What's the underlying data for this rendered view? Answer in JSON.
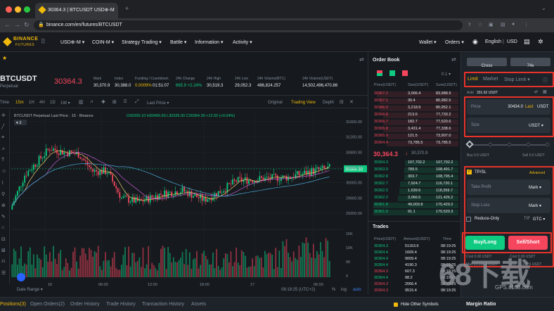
{
  "browser": {
    "tab_title": "30364.3 | BTCUSDT USD⊕-M",
    "url": "binance.com/en/futures/BTCUSDT",
    "new_tab_icon": "plus-icon"
  },
  "nav": {
    "logo_line1": "BINANCE",
    "logo_line2": "FUTURES",
    "items": [
      "USD⊕-M ▾",
      "COIN-M ▾",
      "Strategy Trading ▾",
      "Battle ▾",
      "Information ▾",
      "Activity ▾"
    ],
    "wallet": "Wallet ▾",
    "orders": "Orders ▾",
    "language": "English",
    "currency": "USD"
  },
  "ticker": {
    "symbol": "BTCUSDT",
    "type": "Perpetual",
    "last_price": "30364.3",
    "stats": [
      {
        "label": "Mark",
        "value": "30,370.9",
        "color": "w"
      },
      {
        "label": "Index",
        "value": "30,388.0",
        "color": "w"
      },
      {
        "label": "Funding / Countdown",
        "value": "0.0009%",
        "value2": "01:51:07",
        "color": "y"
      },
      {
        "label": "24h Change",
        "value": "665.9 +2.24%",
        "color": "g"
      },
      {
        "label": "24h High",
        "value": "30,519.3",
        "color": "w"
      },
      {
        "label": "24h Low",
        "value": "29,052.3",
        "color": "w"
      },
      {
        "label": "24h Volume(BTC)",
        "value": "486,824.257",
        "color": "w"
      },
      {
        "label": "24h Volume(USDT)",
        "value": "14,502,496,470.86",
        "color": "w"
      }
    ]
  },
  "chart_toolbar": {
    "intervals": [
      "Time",
      "15m",
      "1H",
      "4H",
      "1D",
      "1W ▾"
    ],
    "active_interval": "15m",
    "last_price_select": "Last Price ▾",
    "views": [
      "Original",
      "Trading View",
      "Depth"
    ],
    "active_view": "Trading View"
  },
  "chart_legend": {
    "title": "BTCUSDT Perpetual Last Price · 15 · Binance",
    "ohlc": "O30350.10 H30406.60 L30335.00 C30364.30 +12.50 (+0.04%)",
    "count": "3"
  },
  "chart_data": {
    "type": "candlestick",
    "price_axis": [
      "31600.00",
      "31200.00",
      "30800.00",
      "30400.00",
      "30000.00",
      "29600.00",
      "29200.00"
    ],
    "volume_axis": [
      "15K",
      "10K",
      "5K",
      "0"
    ],
    "time_axis": [
      "16",
      "06:00",
      "12:00",
      "18:00",
      "17",
      "06:00"
    ],
    "last_price_tag": "30364.30",
    "price_min": 29000,
    "price_max": 31800
  },
  "chart_footer": {
    "date_range": "Date Range ▾",
    "clock": "08:19:25 (UTC+2)",
    "pct": "%",
    "log": "log",
    "auto": "auto"
  },
  "orderbook": {
    "title": "Order Book",
    "precision": "0.1 ▾",
    "headers": [
      "Price(USDT)",
      "Size(USDT)",
      "Sum(USDT)"
    ],
    "asks": [
      [
        "30367.2",
        "3,006.4",
        "83,988.9"
      ],
      [
        "30367.1",
        "30.4",
        "80,982.5"
      ],
      [
        "30366.9",
        "3,218.9",
        "80,952.1"
      ],
      [
        "30366.8",
        "213.6",
        "77,733.2"
      ],
      [
        "30366.7",
        "182.7",
        "77,520.6"
      ],
      [
        "30365.8",
        "3,431.4",
        "77,338.6"
      ],
      [
        "30365.0",
        "121.5",
        "73,907.0"
      ],
      [
        "30364.4",
        "73,785.5",
        "73,785.5"
      ]
    ],
    "mid_price": "30,364.3",
    "mid_arrow": "↓",
    "mid_mark": "30,370.9",
    "bids": [
      [
        "30364.3",
        "107,702.2",
        "107,702.2"
      ],
      [
        "30363.9",
        "789.5",
        "108,491.7"
      ],
      [
        "30362.8",
        "303.7",
        "108,795.4"
      ],
      [
        "30362.7",
        "7,924.7",
        "116,720.1"
      ],
      [
        "30362.5",
        "1,639.6",
        "118,359.7"
      ],
      [
        "30362.2",
        "3,066.5",
        "121,426.2"
      ],
      [
        "30361.8",
        "49,003.8",
        "170,429.2"
      ],
      [
        "30361.0",
        "91.1",
        "170,520.3"
      ]
    ]
  },
  "trades": {
    "title": "Trades",
    "headers": [
      "Price(USDT)",
      "Amount(USDT)",
      "Time"
    ],
    "rows": [
      [
        "30364.3",
        "51163.9",
        "08:19:25",
        "g"
      ],
      [
        "30364.4",
        "1609.4",
        "08:19:25",
        "g"
      ],
      [
        "30364.4",
        "9009.4",
        "08:19:25",
        "g"
      ],
      [
        "30364.4",
        "4190.3",
        "08:19:25",
        "g"
      ],
      [
        "30364.3",
        "607.3",
        "08:19:25",
        "r"
      ],
      [
        "30364.4",
        "98.2",
        "08:19:25",
        "g"
      ],
      [
        "30364.3",
        "2066.4",
        "08:19:25",
        "r"
      ],
      [
        "30364.3",
        "9515.4",
        "08:19:25",
        "r"
      ]
    ]
  },
  "order": {
    "margin_mode": "Cross",
    "leverage": "74x",
    "order_types": [
      "Limit",
      "Market",
      "Stop Limit ▾"
    ],
    "avail_label": "Avbl",
    "avail_value": "331.62 USDT",
    "price_label": "Price",
    "price_value": "30434.0",
    "price_last": "Last",
    "price_unit": "USDT",
    "size_label": "Size",
    "size_unit": "USDT ▾",
    "buy_info": "Buy 0.0 USDT",
    "sell_info": "Sell 0.0 USDT",
    "tpsl_label": "TP/SL",
    "advanced": "Advanced",
    "take_profit": "Take Profit",
    "stop_loss": "Stop Loss",
    "mark1": "Mark ▾",
    "mark2": "Mark ▾",
    "reduce_only": "Reduce-Only",
    "tif_label": "TIF",
    "tif_value": "GTC ▾",
    "buy_btn": "Buy/Long",
    "sell_btn": "Sell/Short",
    "cost1": "Cost 0.00 USDT",
    "cost2": "Cost 0.00 USDT",
    "max1": "Max 21,195.6 USDT",
    "max2": "Max 21,195.6 USDT",
    "margin_ratio": "Margin Ratio"
  },
  "bottom": {
    "tabs": [
      "Positions(3)",
      "Open Orders(2)",
      "Order History",
      "Trade History",
      "Transaction History",
      "Assets"
    ],
    "hide_other": "Hide Other Symbols"
  },
  "watermark": {
    "brand": "68下载",
    "site": "GPS.it168.com"
  },
  "colors": {
    "bg": "#161a1e",
    "panel": "#1e2329",
    "up": "#0ecb81",
    "down": "#f6465d",
    "accent": "#f0b90b",
    "highlight": "#e8322a"
  }
}
